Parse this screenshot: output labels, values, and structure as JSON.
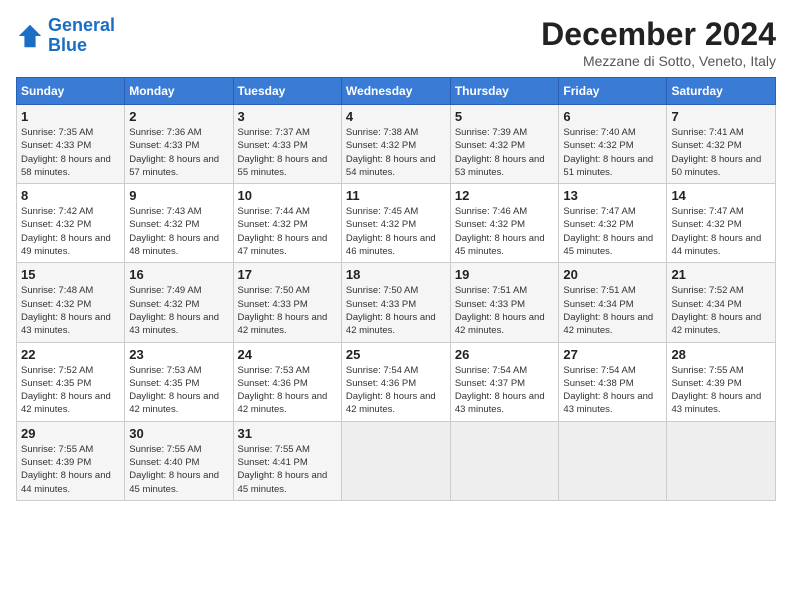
{
  "logo": {
    "line1": "General",
    "line2": "Blue"
  },
  "header": {
    "title": "December 2024",
    "location": "Mezzane di Sotto, Veneto, Italy"
  },
  "weekdays": [
    "Sunday",
    "Monday",
    "Tuesday",
    "Wednesday",
    "Thursday",
    "Friday",
    "Saturday"
  ],
  "days": [
    null,
    null,
    {
      "num": "1",
      "sunrise": "7:35 AM",
      "sunset": "4:33 PM",
      "daylight": "8 hours and 58 minutes."
    },
    {
      "num": "2",
      "sunrise": "7:36 AM",
      "sunset": "4:33 PM",
      "daylight": "8 hours and 57 minutes."
    },
    {
      "num": "3",
      "sunrise": "7:37 AM",
      "sunset": "4:33 PM",
      "daylight": "8 hours and 55 minutes."
    },
    {
      "num": "4",
      "sunrise": "7:38 AM",
      "sunset": "4:32 PM",
      "daylight": "8 hours and 54 minutes."
    },
    {
      "num": "5",
      "sunrise": "7:39 AM",
      "sunset": "4:32 PM",
      "daylight": "8 hours and 53 minutes."
    },
    {
      "num": "6",
      "sunrise": "7:40 AM",
      "sunset": "4:32 PM",
      "daylight": "8 hours and 51 minutes."
    },
    {
      "num": "7",
      "sunrise": "7:41 AM",
      "sunset": "4:32 PM",
      "daylight": "8 hours and 50 minutes."
    },
    {
      "num": "8",
      "sunrise": "7:42 AM",
      "sunset": "4:32 PM",
      "daylight": "8 hours and 49 minutes."
    },
    {
      "num": "9",
      "sunrise": "7:43 AM",
      "sunset": "4:32 PM",
      "daylight": "8 hours and 48 minutes."
    },
    {
      "num": "10",
      "sunrise": "7:44 AM",
      "sunset": "4:32 PM",
      "daylight": "8 hours and 47 minutes."
    },
    {
      "num": "11",
      "sunrise": "7:45 AM",
      "sunset": "4:32 PM",
      "daylight": "8 hours and 46 minutes."
    },
    {
      "num": "12",
      "sunrise": "7:46 AM",
      "sunset": "4:32 PM",
      "daylight": "8 hours and 45 minutes."
    },
    {
      "num": "13",
      "sunrise": "7:47 AM",
      "sunset": "4:32 PM",
      "daylight": "8 hours and 45 minutes."
    },
    {
      "num": "14",
      "sunrise": "7:47 AM",
      "sunset": "4:32 PM",
      "daylight": "8 hours and 44 minutes."
    },
    {
      "num": "15",
      "sunrise": "7:48 AM",
      "sunset": "4:32 PM",
      "daylight": "8 hours and 43 minutes."
    },
    {
      "num": "16",
      "sunrise": "7:49 AM",
      "sunset": "4:32 PM",
      "daylight": "8 hours and 43 minutes."
    },
    {
      "num": "17",
      "sunrise": "7:50 AM",
      "sunset": "4:33 PM",
      "daylight": "8 hours and 42 minutes."
    },
    {
      "num": "18",
      "sunrise": "7:50 AM",
      "sunset": "4:33 PM",
      "daylight": "8 hours and 42 minutes."
    },
    {
      "num": "19",
      "sunrise": "7:51 AM",
      "sunset": "4:33 PM",
      "daylight": "8 hours and 42 minutes."
    },
    {
      "num": "20",
      "sunrise": "7:51 AM",
      "sunset": "4:34 PM",
      "daylight": "8 hours and 42 minutes."
    },
    {
      "num": "21",
      "sunrise": "7:52 AM",
      "sunset": "4:34 PM",
      "daylight": "8 hours and 42 minutes."
    },
    {
      "num": "22",
      "sunrise": "7:52 AM",
      "sunset": "4:35 PM",
      "daylight": "8 hours and 42 minutes."
    },
    {
      "num": "23",
      "sunrise": "7:53 AM",
      "sunset": "4:35 PM",
      "daylight": "8 hours and 42 minutes."
    },
    {
      "num": "24",
      "sunrise": "7:53 AM",
      "sunset": "4:36 PM",
      "daylight": "8 hours and 42 minutes."
    },
    {
      "num": "25",
      "sunrise": "7:54 AM",
      "sunset": "4:36 PM",
      "daylight": "8 hours and 42 minutes."
    },
    {
      "num": "26",
      "sunrise": "7:54 AM",
      "sunset": "4:37 PM",
      "daylight": "8 hours and 43 minutes."
    },
    {
      "num": "27",
      "sunrise": "7:54 AM",
      "sunset": "4:38 PM",
      "daylight": "8 hours and 43 minutes."
    },
    {
      "num": "28",
      "sunrise": "7:55 AM",
      "sunset": "4:39 PM",
      "daylight": "8 hours and 43 minutes."
    },
    {
      "num": "29",
      "sunrise": "7:55 AM",
      "sunset": "4:39 PM",
      "daylight": "8 hours and 44 minutes."
    },
    {
      "num": "30",
      "sunrise": "7:55 AM",
      "sunset": "4:40 PM",
      "daylight": "8 hours and 45 minutes."
    },
    {
      "num": "31",
      "sunrise": "7:55 AM",
      "sunset": "4:41 PM",
      "daylight": "8 hours and 45 minutes."
    },
    null,
    null,
    null,
    null,
    null
  ]
}
